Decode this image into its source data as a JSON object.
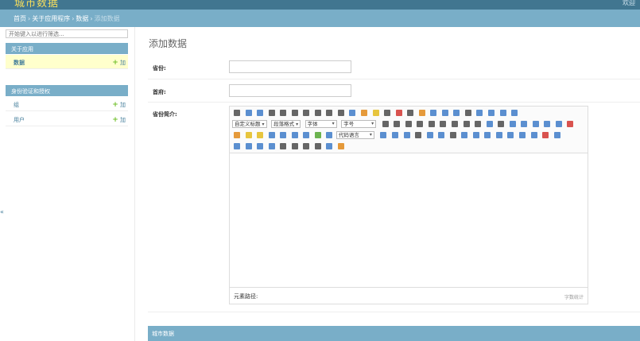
{
  "header": {
    "site_title": "城市数据",
    "right_text": "欢迎"
  },
  "breadcrumbs": {
    "home": "首页",
    "app": "关于应用程序",
    "model": "数据",
    "current": "添加数据",
    "sep": "›"
  },
  "sidebar": {
    "filter_placeholder": "开始键入以进行筛选...",
    "modules": [
      {
        "caption": "关于应用",
        "items": [
          {
            "label": "数据",
            "add": "加"
          }
        ]
      },
      {
        "caption": "身份验证和授权",
        "items": [
          {
            "label": "组",
            "add": "加"
          },
          {
            "label": "用户",
            "add": "加"
          }
        ]
      }
    ],
    "collapse_symbol": "«"
  },
  "main": {
    "title": "添加数据",
    "fields": [
      {
        "label": "省份:"
      },
      {
        "label": "首府:"
      },
      {
        "label": "省份简介:"
      }
    ],
    "editor": {
      "toolbar": {
        "custom_title": "自定义标题",
        "paragraph_format": "段落格式",
        "font_family": "字体",
        "font_size": "字号",
        "code_language": "代码语言"
      },
      "footer_path": "元素路径:",
      "word_count": "字数统计"
    },
    "inline_caption": "城市数据"
  }
}
